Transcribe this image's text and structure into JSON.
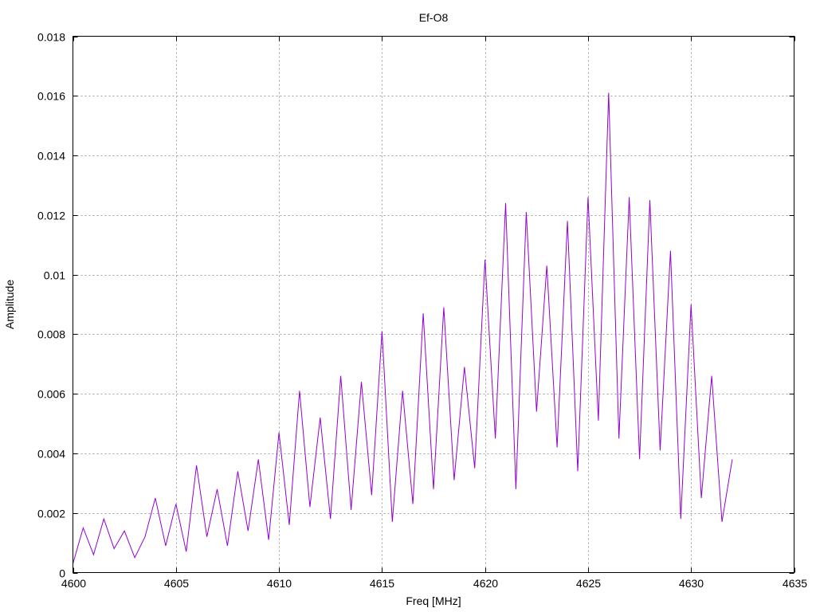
{
  "chart_data": {
    "type": "line",
    "title": "Ef-O8",
    "xlabel": "Freq [MHz]",
    "ylabel": "Amplitude",
    "xlim": [
      4600,
      4635
    ],
    "ylim": [
      0,
      0.018
    ],
    "x_ticks": [
      4600,
      4605,
      4610,
      4615,
      4620,
      4625,
      4630,
      4635
    ],
    "x_tick_labels": [
      "4600",
      "4605",
      "4610",
      "4615",
      "4620",
      "4625",
      "4630",
      "4635"
    ],
    "y_ticks": [
      0,
      0.002,
      0.004,
      0.006,
      0.008,
      0.01,
      0.012,
      0.014,
      0.016,
      0.018
    ],
    "y_tick_labels": [
      "0",
      "0.002",
      "0.004",
      "0.006",
      "0.008",
      "0.01",
      "0.012",
      "0.014",
      "0.016",
      "0.018"
    ],
    "grid": true,
    "legend": "none",
    "series": [
      {
        "color": "#9400d3",
        "x": [
          4600.0,
          4600.5,
          4601.0,
          4601.5,
          4602.0,
          4602.5,
          4603.0,
          4603.5,
          4604.0,
          4604.5,
          4605.0,
          4605.5,
          4606.0,
          4606.5,
          4607.0,
          4607.5,
          4608.0,
          4608.5,
          4609.0,
          4609.5,
          4610.0,
          4610.5,
          4611.0,
          4611.5,
          4612.0,
          4612.5,
          4613.0,
          4613.5,
          4614.0,
          4614.5,
          4615.0,
          4615.5,
          4616.0,
          4616.5,
          4617.0,
          4617.5,
          4618.0,
          4618.5,
          4619.0,
          4619.5,
          4620.0,
          4620.5,
          4621.0,
          4621.5,
          4622.0,
          4622.5,
          4623.0,
          4623.5,
          4624.0,
          4624.5,
          4625.0,
          4625.5,
          4626.0,
          4626.5,
          4627.0,
          4627.5,
          4628.0,
          4628.5,
          4629.0,
          4629.5,
          4630.0,
          4630.5,
          4631.0,
          4631.5,
          4632.0
        ],
        "y": [
          0.0003,
          0.0015,
          0.0006,
          0.0018,
          0.0008,
          0.0014,
          0.0005,
          0.0012,
          0.0025,
          0.0009,
          0.0023,
          0.0007,
          0.0036,
          0.0012,
          0.0028,
          0.0009,
          0.0034,
          0.0014,
          0.0038,
          0.0011,
          0.0047,
          0.0016,
          0.0061,
          0.0022,
          0.0052,
          0.0018,
          0.0066,
          0.0021,
          0.0064,
          0.0026,
          0.0081,
          0.0017,
          0.0061,
          0.0023,
          0.0087,
          0.0028,
          0.0089,
          0.0031,
          0.0069,
          0.0035,
          0.0105,
          0.0045,
          0.0124,
          0.0028,
          0.0121,
          0.0054,
          0.0103,
          0.0042,
          0.0118,
          0.0034,
          0.0126,
          0.0051,
          0.0161,
          0.0045,
          0.0126,
          0.0038,
          0.0125,
          0.0041,
          0.0108,
          0.0018,
          0.009,
          0.0025,
          0.0066,
          0.0017,
          0.0038
        ]
      }
    ]
  }
}
